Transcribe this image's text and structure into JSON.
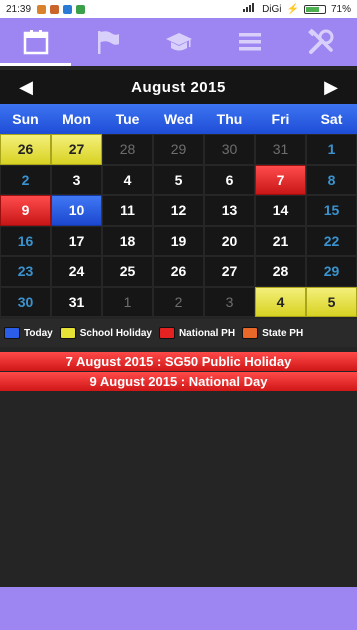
{
  "status_bar": {
    "time": "21:39",
    "carrier": "DiGi",
    "battery": "71%",
    "battery_level": 0.71
  },
  "tabs": [
    {
      "icon": "calendar-icon",
      "active": true
    },
    {
      "icon": "flag-icon",
      "active": false
    },
    {
      "icon": "graduation-cap-icon",
      "active": false
    },
    {
      "icon": "menu-icon",
      "active": false
    },
    {
      "icon": "tools-icon",
      "active": false
    }
  ],
  "calendar": {
    "month_label": "August  2015",
    "prev_icon": "left-arrow-icon",
    "next_icon": "right-arrow-icon",
    "weekdays": [
      "Sun",
      "Mon",
      "Tue",
      "Wed",
      "Thu",
      "Fri",
      "Sat"
    ],
    "weeks": [
      [
        {
          "d": "26",
          "t": "school"
        },
        {
          "d": "27",
          "t": "school"
        },
        {
          "d": "28",
          "t": "other"
        },
        {
          "d": "29",
          "t": "other"
        },
        {
          "d": "30",
          "t": "other"
        },
        {
          "d": "31",
          "t": "other"
        },
        {
          "d": "1",
          "t": "weekend"
        }
      ],
      [
        {
          "d": "2",
          "t": "weekend"
        },
        {
          "d": "3",
          "t": ""
        },
        {
          "d": "4",
          "t": ""
        },
        {
          "d": "5",
          "t": ""
        },
        {
          "d": "6",
          "t": ""
        },
        {
          "d": "7",
          "t": "national"
        },
        {
          "d": "8",
          "t": "weekend"
        }
      ],
      [
        {
          "d": "9",
          "t": "national"
        },
        {
          "d": "10",
          "t": "today"
        },
        {
          "d": "11",
          "t": ""
        },
        {
          "d": "12",
          "t": ""
        },
        {
          "d": "13",
          "t": ""
        },
        {
          "d": "14",
          "t": ""
        },
        {
          "d": "15",
          "t": "weekend"
        }
      ],
      [
        {
          "d": "16",
          "t": "weekend"
        },
        {
          "d": "17",
          "t": ""
        },
        {
          "d": "18",
          "t": ""
        },
        {
          "d": "19",
          "t": ""
        },
        {
          "d": "20",
          "t": ""
        },
        {
          "d": "21",
          "t": ""
        },
        {
          "d": "22",
          "t": "weekend"
        }
      ],
      [
        {
          "d": "23",
          "t": "weekend"
        },
        {
          "d": "24",
          "t": ""
        },
        {
          "d": "25",
          "t": ""
        },
        {
          "d": "26",
          "t": ""
        },
        {
          "d": "27",
          "t": ""
        },
        {
          "d": "28",
          "t": ""
        },
        {
          "d": "29",
          "t": "weekend"
        }
      ],
      [
        {
          "d": "30",
          "t": "weekend"
        },
        {
          "d": "31",
          "t": ""
        },
        {
          "d": "1",
          "t": "other"
        },
        {
          "d": "2",
          "t": "other"
        },
        {
          "d": "3",
          "t": "other"
        },
        {
          "d": "4",
          "t": "school"
        },
        {
          "d": "5",
          "t": "school"
        }
      ]
    ]
  },
  "legend": [
    {
      "label": "Today",
      "color": "#2a5ee8"
    },
    {
      "label": "School Holiday",
      "color": "#e6e236"
    },
    {
      "label": "National PH",
      "color": "#e52222"
    },
    {
      "label": "State PH",
      "color": "#e8682a"
    }
  ],
  "events": [
    {
      "text": "7 August 2015 : SG50 Public Holiday"
    },
    {
      "text": "9 August 2015 : National Day"
    }
  ],
  "colors": {
    "accent": "#9e86f2",
    "background": "#252525"
  }
}
